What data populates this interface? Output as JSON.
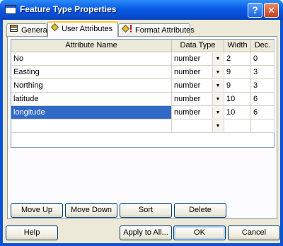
{
  "window": {
    "title": "Feature Type Properties"
  },
  "tabs": [
    {
      "label": "General",
      "icon": "table-icon",
      "active": false
    },
    {
      "label": "User Attributes",
      "icon": "diamond-icon",
      "active": true
    },
    {
      "label": "Format Attributes",
      "icon": "diamond-warning-icon",
      "active": false
    }
  ],
  "grid": {
    "columns": [
      "Attribute Name",
      "Data Type",
      "Width",
      "Dec."
    ],
    "rows": [
      {
        "name": "No",
        "type": "number",
        "width": "2",
        "dec": "0"
      },
      {
        "name": "Easting",
        "type": "number",
        "width": "9",
        "dec": "3"
      },
      {
        "name": "Northing",
        "type": "number",
        "width": "9",
        "dec": "3"
      },
      {
        "name": "latitude",
        "type": "number",
        "width": "10",
        "dec": "6"
      },
      {
        "name": "longitude",
        "type": "number",
        "width": "10",
        "dec": "6",
        "selected": true
      },
      {
        "name": "",
        "type": "",
        "width": "",
        "dec": ""
      }
    ]
  },
  "row_buttons": {
    "move_up": "Move Up",
    "move_down": "Move Down",
    "sort": "Sort",
    "delete": "Delete"
  },
  "dialog_buttons": {
    "help": "Help",
    "apply_all": "Apply to All...",
    "ok": "OK",
    "cancel": "Cancel"
  },
  "colors": {
    "title_bar": "#0a5ae8",
    "selection": "#316ac5",
    "face": "#ece9d8"
  }
}
